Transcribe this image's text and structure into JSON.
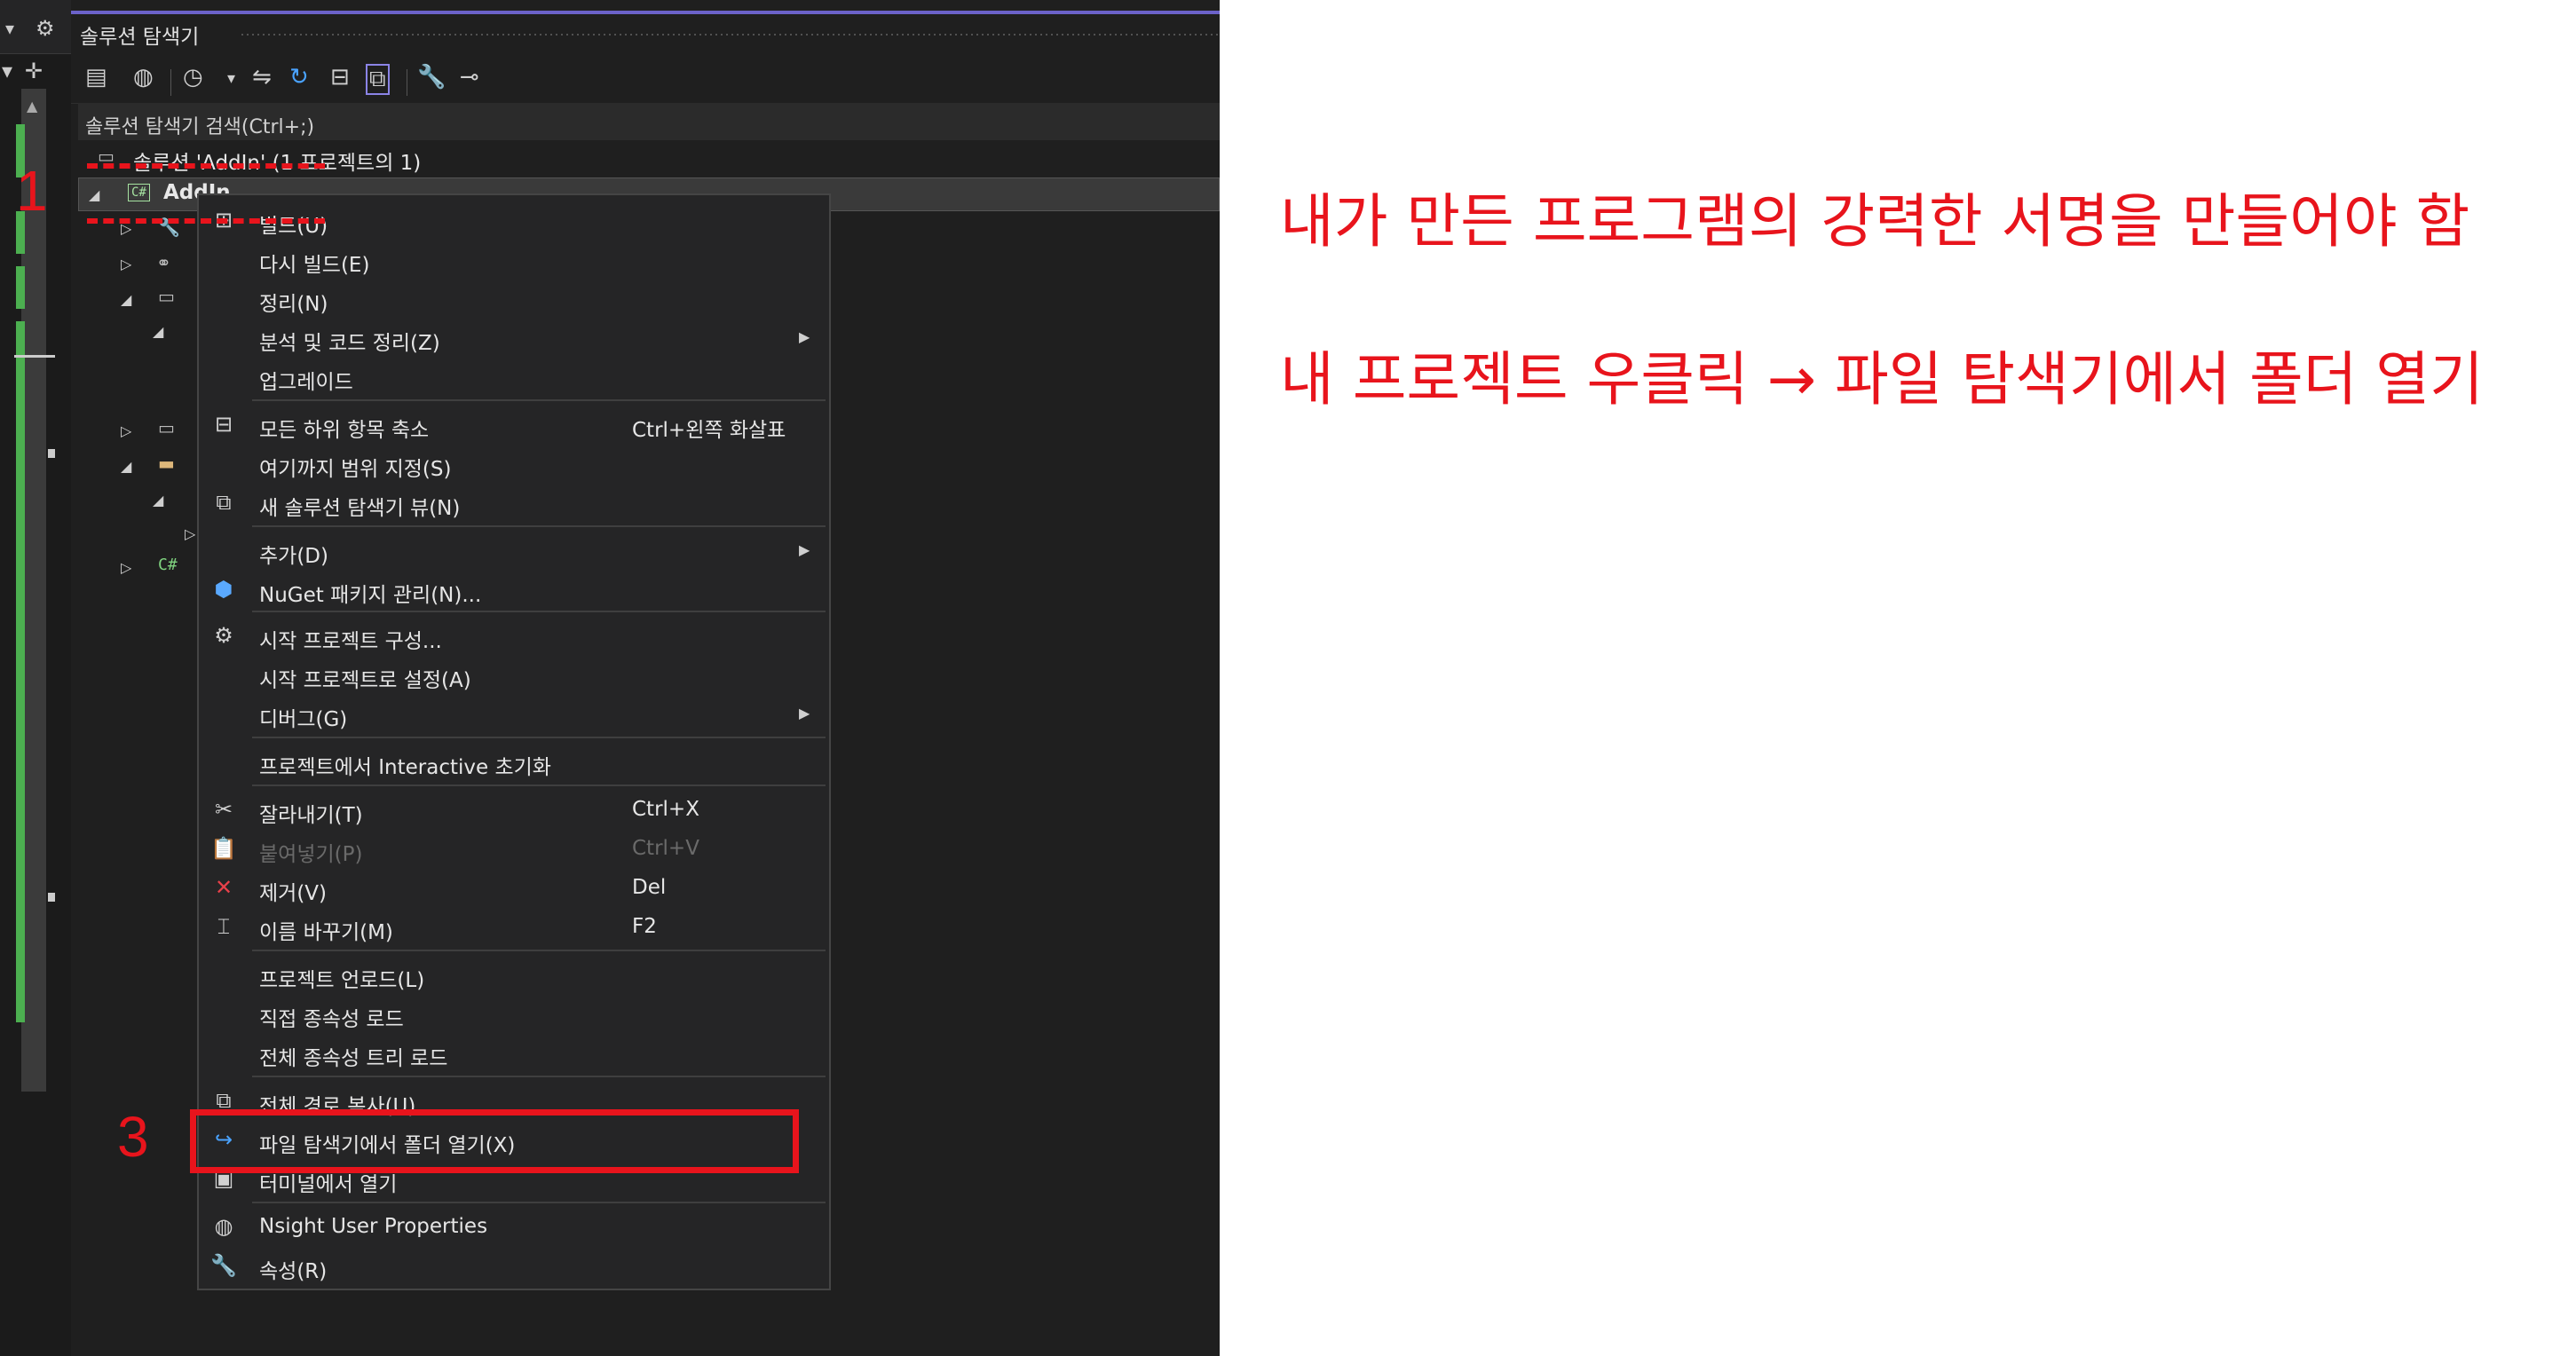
{
  "panel": {
    "title": "솔루션 탐색기",
    "search_placeholder": "솔루션 탐색기 검색(Ctrl+;)",
    "solution_label": "솔루션 'AddIn' (1 프로젝트의 1)",
    "project_label": "AddIn"
  },
  "context_menu": {
    "items": [
      {
        "label": "빌드(U)",
        "icon": "build-icon"
      },
      {
        "label": "다시 빌드(E)"
      },
      {
        "label": "정리(N)"
      },
      {
        "label": "분석 및 코드 정리(Z)",
        "submenu": true
      },
      {
        "label": "업그레이드"
      },
      {
        "label": "모든 하위 항목 축소",
        "shortcut": "Ctrl+왼쪽 화살표",
        "icon": "collapse-all-icon"
      },
      {
        "label": "여기까지 범위 지정(S)"
      },
      {
        "label": "새 솔루션 탐색기 뷰(N)",
        "icon": "new-view-icon"
      },
      {
        "label": "추가(D)",
        "submenu": true
      },
      {
        "label": "NuGet 패키지 관리(N)...",
        "icon": "nuget-icon"
      },
      {
        "label": "시작 프로젝트 구성...",
        "icon": "gear-icon"
      },
      {
        "label": "시작 프로젝트로 설정(A)"
      },
      {
        "label": "디버그(G)",
        "submenu": true
      },
      {
        "label": "프로젝트에서 Interactive 초기화"
      },
      {
        "label": "잘라내기(T)",
        "shortcut": "Ctrl+X",
        "icon": "scissors-icon"
      },
      {
        "label": "붙여넣기(P)",
        "shortcut": "Ctrl+V",
        "icon": "paste-icon",
        "disabled": true
      },
      {
        "label": "제거(V)",
        "shortcut": "Del",
        "icon": "remove-icon"
      },
      {
        "label": "이름 바꾸기(M)",
        "shortcut": "F2",
        "icon": "rename-icon"
      },
      {
        "label": "프로젝트 언로드(L)"
      },
      {
        "label": "직접 종속성 로드"
      },
      {
        "label": "전체 종속성 트리 로드"
      },
      {
        "label": "전체 경로 복사(U)",
        "icon": "copy-path-icon"
      },
      {
        "label": "파일 탐색기에서 폴더 열기(X)",
        "icon": "open-folder-arrow-icon"
      },
      {
        "label": "터미널에서 열기",
        "icon": "terminal-icon"
      },
      {
        "label": "Nsight User Properties",
        "icon": "globe-icon"
      },
      {
        "label": "속성(R)",
        "icon": "wrench-icon"
      }
    ]
  },
  "annotations": {
    "step1": "1",
    "step3": "3",
    "note_line1": "내가 만든 프로그램의 강력한 서명을 만들어야 함",
    "note_line2": "내 프로젝트 우클릭 → 파일 탐색기에서 폴더 열기"
  },
  "colors": {
    "annotation": "#e8141c",
    "accent": "#6b62c9",
    "background": "#1f1f1f",
    "menu": "#252526"
  }
}
